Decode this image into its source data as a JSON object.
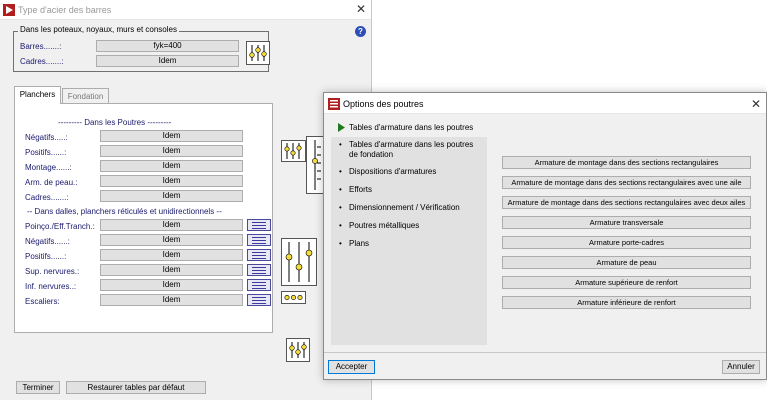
{
  "bars_window": {
    "title": "Type d'acier des barres",
    "group_title": "Dans les poteaux, noyaux, murs et consoles",
    "barres_label": "Barres.......:",
    "barres_value": "fyk=400",
    "cadres_label": "Cadres.......:",
    "cadres_value": "Idem",
    "tabs": [
      {
        "label": "Planchers"
      },
      {
        "label": "Fondation"
      }
    ],
    "poutres_header": "--------- Dans les Poutres ---------",
    "poutres_rows": [
      {
        "label": "Négatifs.....:",
        "value": "Idem"
      },
      {
        "label": "Positifs......:",
        "value": "Idem"
      },
      {
        "label": "Montage......:",
        "value": "Idem"
      },
      {
        "label": "Arm. de peau.:",
        "value": "Idem"
      },
      {
        "label": "Cadres.......:",
        "value": "Idem"
      }
    ],
    "dalles_header": "-- Dans dalles, planchers réticulés et unidirectionnels --",
    "dalles_rows": [
      {
        "label": "Poinço./Eff.Tranch.:",
        "value": "Idem"
      },
      {
        "label": "Négatifs......:",
        "value": "Idem"
      },
      {
        "label": "Positifs......:",
        "value": "Idem"
      },
      {
        "label": "Sup. nervures.:",
        "value": "Idem"
      },
      {
        "label": "Inf. nervures..:",
        "value": "Idem"
      },
      {
        "label": "Escaliers:",
        "value": "Idem"
      }
    ],
    "terminate_label": "Terminer",
    "restore_label": "Restaurer tables par défaut",
    "help_glyph": "?",
    "close_glyph": "✕"
  },
  "options_window": {
    "title": "Options des poutres",
    "close_glyph": "✕",
    "active_item": "Tables d'armature dans les poutres",
    "nav_items": [
      {
        "label": "Tables d'armature dans les poutres de fondation"
      },
      {
        "label": "Dispositions d'armatures"
      },
      {
        "label": "Efforts"
      },
      {
        "label": "Dimensionnement / Vérification"
      },
      {
        "label": "Poutres métalliques"
      },
      {
        "label": "Plans"
      }
    ],
    "buttons": [
      {
        "label": "Armature de montage dans des sections rectangulaires"
      },
      {
        "label": "Armature de montage dans des sections rectangulaires avec une aile"
      },
      {
        "label": "Armature de montage dans des sections rectangulaires avec deux ailes"
      },
      {
        "label": "Armature transversale"
      },
      {
        "label": "Armature porte-cadres"
      },
      {
        "label": "Armature de peau"
      },
      {
        "label": "Armature supérieure de renfort"
      },
      {
        "label": "Armature inférieure de renfort"
      }
    ],
    "accept_label": "Accepter",
    "cancel_label": "Annuler"
  },
  "colors": {
    "label_text": "#1a1a6e",
    "active_arrow": "#1e7a1e",
    "app_icon": "#b01e1e",
    "focus_border": "#0078d7"
  },
  "icons": [
    "app-icon",
    "help-icon",
    "close-icon",
    "sliders-icon",
    "list-icon",
    "arrow-right-icon",
    "bullet-icon"
  ]
}
